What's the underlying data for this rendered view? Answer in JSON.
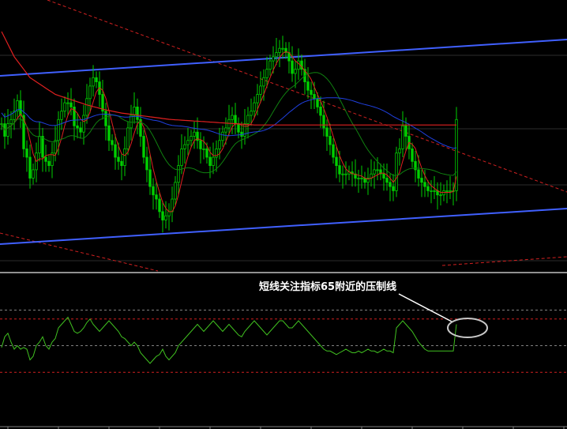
{
  "annotation": {
    "text": "短线关注指标65附近的压制线"
  },
  "colors": {
    "background": "#000000",
    "candle": "#00d000",
    "oscillator": "#40c020",
    "ma_red": "#e02020",
    "ma_blue": "#2040e0",
    "ma_green": "#108010",
    "channel": "#4060ff",
    "dashed_red": "#d02020",
    "grid": "#808080",
    "annotation_circle": "#c8c8c8"
  },
  "chart_data": [
    {
      "type": "line",
      "panel": "price",
      "title": "",
      "xlabel": "",
      "ylabel": "",
      "grid": true,
      "ylim": [
        0,
        100
      ],
      "x_count": 145,
      "series": [
        {
          "role": "close",
          "values": [
            56,
            50,
            56,
            58,
            62,
            67,
            60,
            44,
            40,
            30,
            34,
            42,
            50,
            40,
            38,
            36,
            42,
            48,
            58,
            62,
            66,
            66,
            64,
            55,
            54,
            52,
            60,
            68,
            74,
            78,
            76,
            70,
            62,
            55,
            48,
            46,
            40,
            38,
            36,
            44,
            54,
            60,
            64,
            58,
            50,
            40,
            34,
            26,
            22,
            20,
            14,
            10,
            12,
            14,
            20,
            28,
            36,
            44,
            46,
            48,
            50,
            52,
            48,
            44,
            44,
            40,
            36,
            40,
            44,
            48,
            52,
            54,
            58,
            60,
            56,
            52,
            50,
            56,
            60,
            62,
            66,
            70,
            74,
            78,
            82,
            86,
            88,
            90,
            92,
            92,
            90,
            86,
            80,
            82,
            86,
            82,
            76,
            72,
            70,
            68,
            64,
            60,
            54,
            50,
            46,
            40,
            36,
            32,
            32,
            32,
            33,
            32,
            30,
            30,
            30,
            28,
            30,
            32,
            34,
            34,
            32,
            30,
            28,
            26,
            24,
            42,
            44,
            55,
            50,
            44,
            38,
            34,
            30,
            28,
            26,
            24,
            24,
            24,
            22,
            22,
            24,
            24,
            24,
            24,
            58
          ]
        },
        {
          "role": "ma_red",
          "values": [
            100,
            97,
            94,
            91,
            88,
            86,
            84,
            82,
            80,
            78,
            77,
            76,
            75,
            74,
            73,
            72,
            71,
            70,
            69.5,
            69,
            68.5,
            68,
            67.5,
            67,
            66.5,
            66,
            65.5,
            65,
            64.6,
            64.2,
            63.8,
            63.4,
            63,
            62.6,
            62.3,
            62,
            61.7,
            61.4,
            61.1,
            60.9,
            60.7,
            60.5,
            60.3,
            60.1,
            59.9,
            59.7,
            59.5,
            59.3,
            59.1,
            58.9,
            58.7,
            58.5,
            58.3,
            58.1,
            58,
            57.9,
            57.8,
            57.7,
            57.6,
            57.5,
            57.4,
            57.3,
            57.2,
            57.1,
            57,
            56.9,
            56.8,
            56.7,
            56.6,
            56.5,
            56.4,
            56.3,
            56.2,
            56.1,
            56,
            55.9,
            55.8,
            55.7,
            55.6,
            55.5,
            55.4,
            55.4,
            55.4,
            55.4,
            55.4,
            55.4,
            55.4,
            55.4,
            55.4,
            55.4,
            55.4,
            55.4,
            55.4,
            55.4,
            55.4,
            55.4,
            55.4,
            55.4,
            55.4,
            55.4,
            55.4,
            55.4,
            55.4,
            55.4,
            55.4,
            55.4,
            55.4,
            55.4,
            55.4,
            55.4,
            55.4,
            55.4,
            55.4,
            55.4,
            55.4,
            55.4,
            55.4,
            55.4,
            55.4,
            55.4,
            55.4,
            55.4,
            55.4,
            55.4,
            55.4,
            55.4,
            55.4,
            55.4,
            55.4,
            55.4,
            55.4,
            55.4,
            55.4,
            55.4,
            55.4,
            55.4,
            55.4,
            55.4,
            55.4,
            55.4,
            55.4,
            55.4,
            55.4,
            55.4,
            55.4
          ]
        }
      ]
    },
    {
      "type": "line",
      "panel": "oscillator",
      "title": "",
      "xlabel": "",
      "ylabel": "",
      "grid": true,
      "ylim": [
        20,
        80
      ],
      "levels": [
        70,
        65,
        50,
        35
      ],
      "x_count": 145,
      "series": [
        {
          "role": "oscillator",
          "values": [
            49,
            55,
            57,
            52,
            48,
            50,
            48,
            49,
            48,
            42,
            44,
            50,
            52,
            55,
            50,
            48,
            52,
            54,
            60,
            62,
            64,
            66,
            62,
            58,
            57,
            58,
            60,
            63,
            65,
            62,
            60,
            58,
            60,
            62,
            64,
            62,
            60,
            58,
            55,
            54,
            52,
            50,
            52,
            50,
            46,
            44,
            42,
            40,
            42,
            44,
            45,
            48,
            44,
            42,
            44,
            46,
            50,
            52,
            54,
            56,
            58,
            60,
            62,
            60,
            58,
            60,
            62,
            64,
            62,
            60,
            58,
            60,
            62,
            60,
            58,
            56,
            55,
            58,
            60,
            62,
            64,
            62,
            60,
            58,
            56,
            58,
            60,
            62,
            64,
            64,
            62,
            60,
            60,
            62,
            64,
            62,
            60,
            58,
            56,
            54,
            52,
            50,
            48,
            47,
            47,
            46,
            45,
            46,
            47,
            48,
            47,
            46,
            46,
            47,
            46,
            47,
            48,
            47,
            47,
            46,
            47,
            48,
            47,
            47,
            46,
            60,
            62,
            64,
            62,
            60,
            58,
            55,
            52,
            50,
            48,
            47,
            47,
            47,
            47,
            47,
            47,
            47,
            47,
            47,
            62
          ]
        }
      ]
    }
  ]
}
